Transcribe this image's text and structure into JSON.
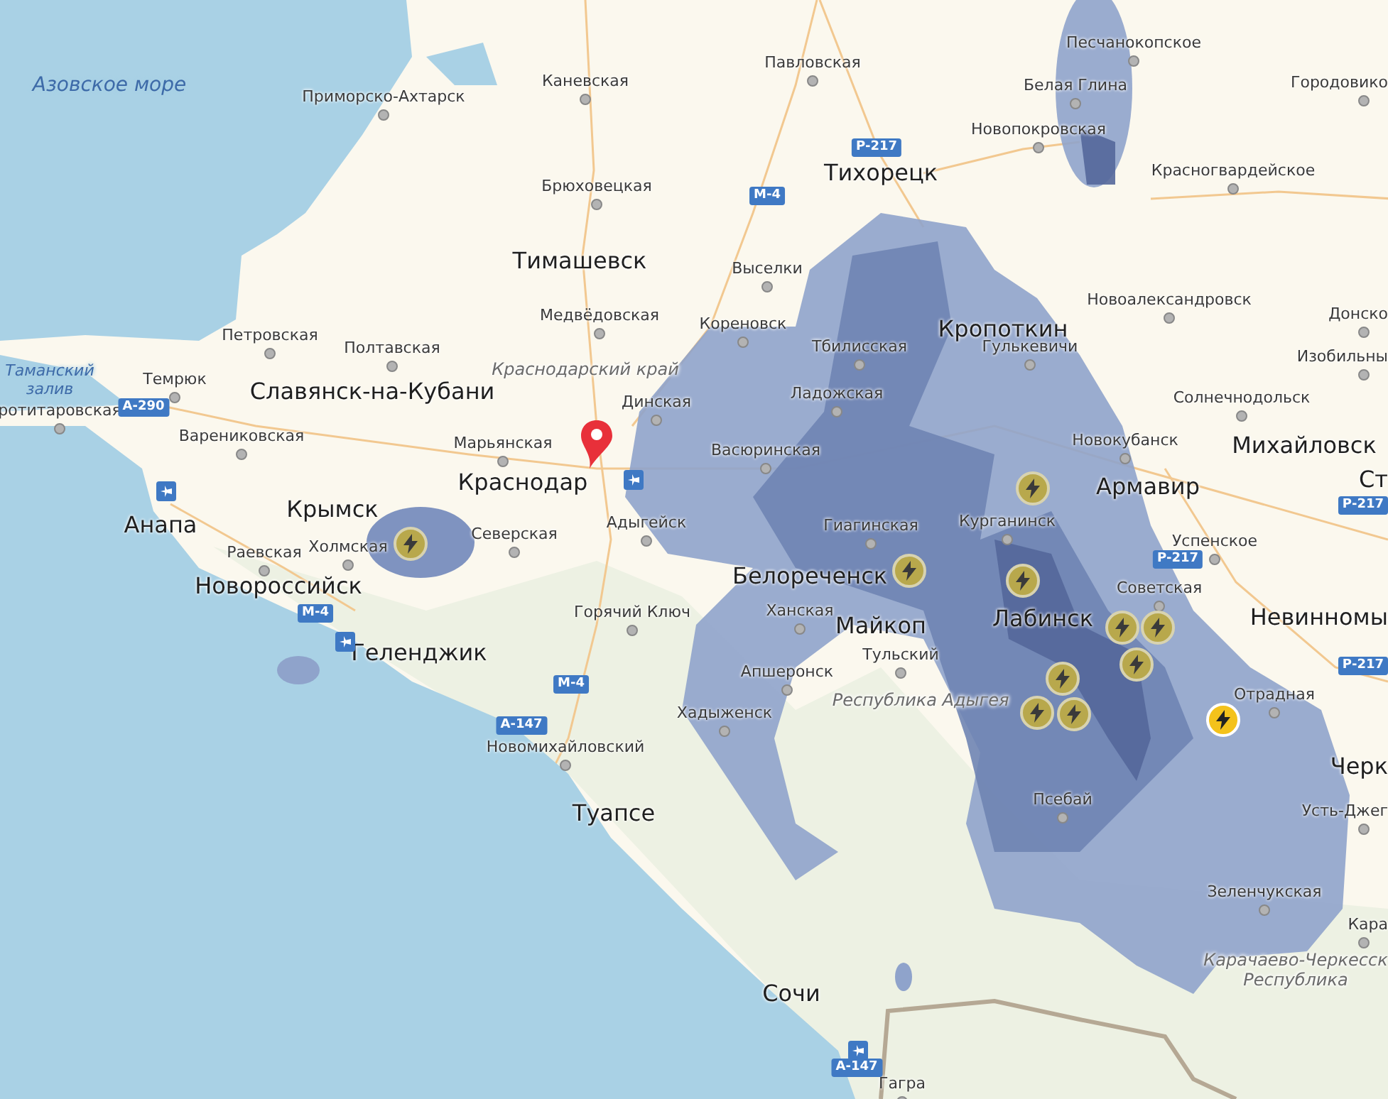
{
  "map": {
    "labels": [
      {
        "text": "Песчанокопское",
        "kind": "town"
      },
      {
        "text": "Павловская",
        "kind": "town"
      },
      {
        "text": "Азовское море",
        "kind": "sea"
      },
      {
        "text": "Приморско-Ахтарск",
        "kind": "town"
      },
      {
        "text": "Каневская",
        "kind": "town"
      },
      {
        "text": "Белая Глина",
        "kind": "town"
      },
      {
        "text": "Городовико",
        "kind": "town"
      },
      {
        "text": "Новопокровская",
        "kind": "town"
      },
      {
        "text": "Брюховецкая",
        "kind": "town"
      },
      {
        "text": "Тихорецк",
        "kind": "city"
      },
      {
        "text": "Красногвардейское",
        "kind": "town"
      },
      {
        "text": "Тимашевск",
        "kind": "city"
      },
      {
        "text": "Выселки",
        "kind": "town"
      },
      {
        "text": "Медвёдовская",
        "kind": "town"
      },
      {
        "text": "Новоалександровск",
        "kind": "town"
      },
      {
        "text": "Петровская",
        "kind": "town"
      },
      {
        "text": "Полтавская",
        "kind": "town"
      },
      {
        "text": "Кореновск",
        "kind": "town"
      },
      {
        "text": "Тбилисская",
        "kind": "town"
      },
      {
        "text": "Кропоткин",
        "kind": "city"
      },
      {
        "text": "Гулькевичи",
        "kind": "town"
      },
      {
        "text": "Донско",
        "kind": "town"
      },
      {
        "text": "Таманский залив",
        "kind": "sea"
      },
      {
        "text": "Темрюк",
        "kind": "town"
      },
      {
        "text": "ротитаровская",
        "kind": "town"
      },
      {
        "text": "Краснодарский край",
        "kind": "region"
      },
      {
        "text": "Изобильны",
        "kind": "town"
      },
      {
        "text": "Славянск-на-Кубани",
        "kind": "city"
      },
      {
        "text": "Динская",
        "kind": "town"
      },
      {
        "text": "Ладожская",
        "kind": "town"
      },
      {
        "text": "Солнечнодольск",
        "kind": "town"
      },
      {
        "text": "Вареникoвская",
        "kind": "town"
      },
      {
        "text": "Марьянская",
        "kind": "town"
      },
      {
        "text": "Васюринская",
        "kind": "town"
      },
      {
        "text": "Новокубанск",
        "kind": "town"
      },
      {
        "text": "Михайловск",
        "kind": "city"
      },
      {
        "text": "Краснодар",
        "kind": "city"
      },
      {
        "text": "Анапа",
        "kind": "city"
      },
      {
        "text": "Крымск",
        "kind": "city"
      },
      {
        "text": "Армавир",
        "kind": "city"
      },
      {
        "text": "Ст",
        "kind": "city"
      },
      {
        "text": "Раевская",
        "kind": "town"
      },
      {
        "text": "Холмская",
        "kind": "town"
      },
      {
        "text": "Северская",
        "kind": "town"
      },
      {
        "text": "Адыгейск",
        "kind": "town"
      },
      {
        "text": "Гиагинская",
        "kind": "town"
      },
      {
        "text": "Курганинск",
        "kind": "town"
      },
      {
        "text": "Успенское",
        "kind": "town"
      },
      {
        "text": "Новороссийск",
        "kind": "city"
      },
      {
        "text": "Белореченск",
        "kind": "city"
      },
      {
        "text": "Советская",
        "kind": "town"
      },
      {
        "text": "Горячий Ключ",
        "kind": "town"
      },
      {
        "text": "Ханская",
        "kind": "town"
      },
      {
        "text": "Майкоп",
        "kind": "city"
      },
      {
        "text": "Лабинск",
        "kind": "city"
      },
      {
        "text": "Невинномы",
        "kind": "city"
      },
      {
        "text": "Геленджик",
        "kind": "city"
      },
      {
        "text": "Тульский",
        "kind": "town"
      },
      {
        "text": "Апшеронск",
        "kind": "town"
      },
      {
        "text": "Хадыженск",
        "kind": "town"
      },
      {
        "text": "Республика Адыгея",
        "kind": "region"
      },
      {
        "text": "Отрадная",
        "kind": "town"
      },
      {
        "text": "Новомихайловский",
        "kind": "town"
      },
      {
        "text": "Черк",
        "kind": "city"
      },
      {
        "text": "Туапсе",
        "kind": "city"
      },
      {
        "text": "Псебай",
        "kind": "town"
      },
      {
        "text": "Усть-Джег",
        "kind": "town"
      },
      {
        "text": "Зеленчукская",
        "kind": "town"
      },
      {
        "text": "Кара",
        "kind": "town"
      },
      {
        "text": "Сочи",
        "kind": "city"
      },
      {
        "text": "Карачаево-Черкесск Республика",
        "kind": "region"
      },
      {
        "text": "Гагра",
        "kind": "town"
      }
    ],
    "road_badges": [
      "Р-217",
      "М-4",
      "А-290",
      "М-4",
      "М-4",
      "А-147",
      "Р-217",
      "Р-217",
      "Р-217",
      "А-147"
    ],
    "lightning": [
      {
        "recent": false
      },
      {
        "recent": false
      },
      {
        "recent": false
      },
      {
        "recent": false
      },
      {
        "recent": false
      },
      {
        "recent": false
      },
      {
        "recent": false
      },
      {
        "recent": false
      },
      {
        "recent": false
      },
      {
        "recent": false
      },
      {
        "recent": true
      }
    ]
  }
}
